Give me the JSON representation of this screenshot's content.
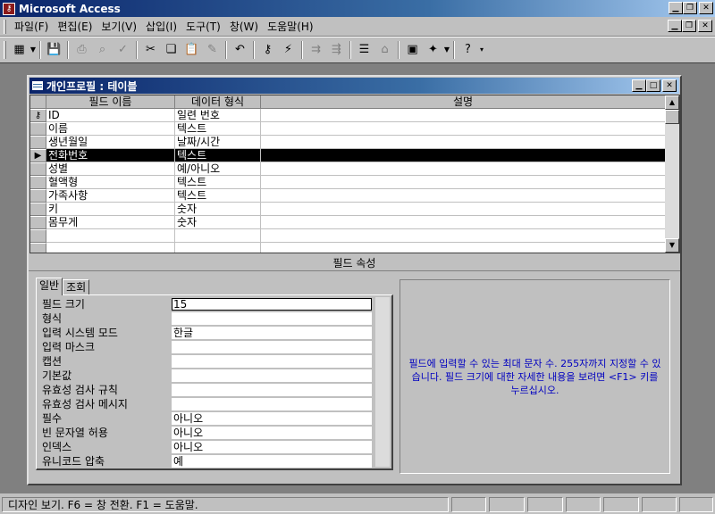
{
  "app": {
    "title": "Microsoft Access",
    "icon": "access-key-icon"
  },
  "menu": {
    "items": [
      "파일(F)",
      "편집(E)",
      "보기(V)",
      "삽입(I)",
      "도구(T)",
      "창(W)",
      "도움말(H)"
    ]
  },
  "toolbar": {
    "buttons": [
      "view-icon",
      "save-icon",
      "print-icon",
      "print-preview-icon",
      "spelling-icon",
      "cut-icon",
      "copy-icon",
      "paste-icon",
      "format-painter-icon",
      "undo-icon",
      "primary-key-icon",
      "build-icon",
      "insert-rows-icon",
      "delete-rows-icon",
      "properties-icon",
      "build-wizard-icon",
      "database-window-icon",
      "new-object-icon",
      "help-icon"
    ]
  },
  "table_window": {
    "title": "개인프로필 : 테이블",
    "columns": [
      "필드 이름",
      "데이터 형식",
      "설명"
    ],
    "rows": [
      {
        "indicator": "key",
        "name": "ID",
        "type": "일련 번호",
        "desc": ""
      },
      {
        "indicator": "",
        "name": "이름",
        "type": "텍스트",
        "desc": ""
      },
      {
        "indicator": "",
        "name": "생년월일",
        "type": "날짜/시간",
        "desc": ""
      },
      {
        "indicator": "current",
        "name": "전화번호",
        "type": "텍스트",
        "desc": ""
      },
      {
        "indicator": "",
        "name": "성별",
        "type": "예/아니오",
        "desc": ""
      },
      {
        "indicator": "",
        "name": "혈액형",
        "type": "텍스트",
        "desc": ""
      },
      {
        "indicator": "",
        "name": "가족사항",
        "type": "텍스트",
        "desc": ""
      },
      {
        "indicator": "",
        "name": "키",
        "type": "숫자",
        "desc": ""
      },
      {
        "indicator": "",
        "name": "몸무게",
        "type": "숫자",
        "desc": ""
      },
      {
        "indicator": "",
        "name": "",
        "type": "",
        "desc": ""
      },
      {
        "indicator": "",
        "name": "",
        "type": "",
        "desc": ""
      }
    ],
    "field_properties_label": "필드 속성",
    "tabs": [
      "일반",
      "조회"
    ],
    "properties": [
      {
        "label": "필드 크기",
        "value": "15"
      },
      {
        "label": "형식",
        "value": ""
      },
      {
        "label": "입력 시스템 모드",
        "value": "한글"
      },
      {
        "label": "입력 마스크",
        "value": ""
      },
      {
        "label": "캡션",
        "value": ""
      },
      {
        "label": "기본값",
        "value": ""
      },
      {
        "label": "유효성 검사 규칙",
        "value": ""
      },
      {
        "label": "유효성 검사 메시지",
        "value": ""
      },
      {
        "label": "필수",
        "value": "아니오"
      },
      {
        "label": "빈 문자열 허용",
        "value": "아니오"
      },
      {
        "label": "인덱스",
        "value": "아니오"
      },
      {
        "label": "유니코드 압축",
        "value": "예"
      }
    ],
    "help_text": "필드에 입력할 수 있는 최대 문자 수. 255자까지 지정할 수 있습니다. 필드 크기에 대한 자세한 내용을 보려면 <F1> 키를 누르십시오."
  },
  "status": {
    "text": "디자인 보기.  F6 = 창 전환.  F1 = 도움말."
  },
  "colors": {
    "titlebar": "#0a246a",
    "face": "#c0c0c0",
    "workspace": "#808080",
    "help_text": "#0000c0"
  }
}
